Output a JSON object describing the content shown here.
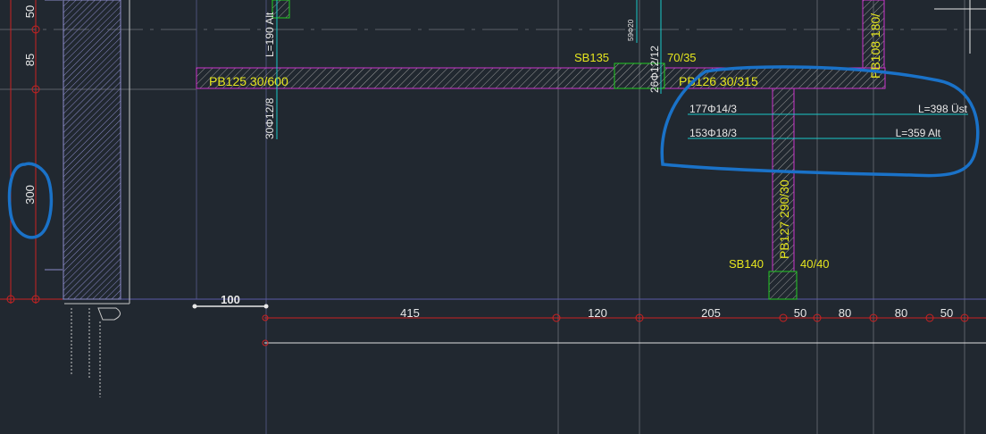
{
  "colors": {
    "background": "#212830",
    "beam_outline": "#cc33cc",
    "column_outline": "#22cc22",
    "beam_label": "#e6e61e",
    "rebar_line": "#19c8c8",
    "dimension_line": "#cc2222",
    "grid_line": "#6a6aa8",
    "annotation_marker": "#1a72c8"
  },
  "left_dimensions": {
    "d50": "50",
    "d85": "85",
    "d300": "300"
  },
  "scale_label": "100",
  "bottom_dimensions": [
    "415",
    "120",
    "205",
    "50",
    "80",
    "80",
    "50"
  ],
  "beams": {
    "pb125": "PB125 30/600",
    "pb126": "PB126 30/315",
    "pb127": "PB127 290/30",
    "pb108": "PB108 180/"
  },
  "columns": {
    "sb135_name": "SB135",
    "sb135_size": "70/35",
    "sb140_name": "SB140",
    "sb140_size": "40/40"
  },
  "rebar": {
    "top_bar": "L=190 Alt",
    "vert_bar": "30Φ12/8",
    "mid_bar": "26Φ12/12",
    "small_bar": "59Φ20",
    "line1_left": "177Φ14/3",
    "line1_right": "L=398 Üst",
    "line2_left": "153Φ18/3",
    "line2_right": "L=359 Alt"
  }
}
